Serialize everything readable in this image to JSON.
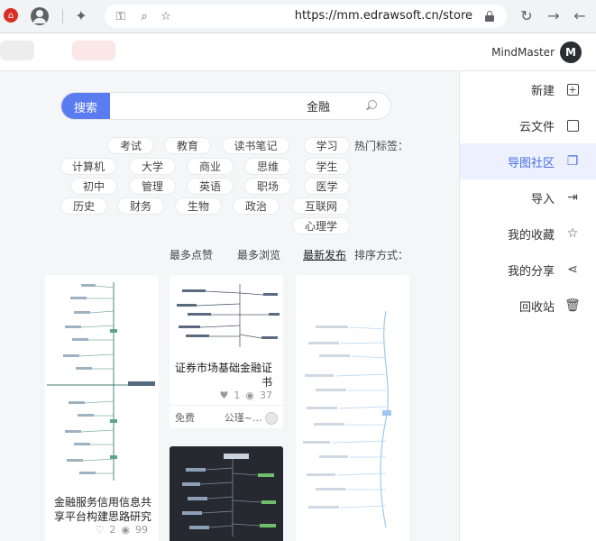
{
  "browser": {
    "url": "https://mm.edrawsoft.cn/store",
    "back_icon": "arrow-left",
    "forward_icon": "arrow-right",
    "reload_icon": "reload"
  },
  "header": {
    "brand_name": "MindMaster",
    "brand_logo": "M"
  },
  "sidebar": {
    "items": [
      {
        "label": "新建",
        "icon": "plus-square-icon"
      },
      {
        "label": "云文件",
        "icon": "file-icon"
      },
      {
        "label": "导图社区",
        "icon": "copy-icon"
      },
      {
        "label": "导入",
        "icon": "import-icon"
      },
      {
        "label": "我的收藏",
        "icon": "star-icon"
      },
      {
        "label": "我的分享",
        "icon": "share-icon"
      },
      {
        "label": "回收站",
        "icon": "trash-icon"
      }
    ],
    "active_index": 2
  },
  "search": {
    "button_label": "搜索",
    "query": "金融"
  },
  "tags": {
    "label": "热门标签：",
    "rows": [
      [
        "学习",
        "读书笔记",
        "教育",
        "考试"
      ],
      [
        "学生",
        "思维",
        "商业",
        "大学",
        "计算机"
      ],
      [
        "医学",
        "职场",
        "英语",
        "管理",
        "初中"
      ],
      [
        "互联网",
        "政治",
        "生物",
        "财务",
        "历史"
      ],
      [
        "心理学"
      ]
    ]
  },
  "sort": {
    "label": "排序方式：",
    "options": [
      "最新发布",
      "最多浏览",
      "最多点赞"
    ],
    "active_index": 0
  },
  "cards": [
    {
      "title": "金融服务信用信息共享平台构建思路研究",
      "views": "99",
      "likes": "2"
    },
    {
      "title": "证券市场基础金融证书",
      "views": "37",
      "likes": "1",
      "author": "公瑾~...",
      "price": "免费"
    }
  ],
  "colors": {
    "accent": "#5b7cf0",
    "sidebar_active_bg": "#edf1ff",
    "sidebar_active_text": "#4a6ee0",
    "main_bg": "#f5f6f8"
  }
}
